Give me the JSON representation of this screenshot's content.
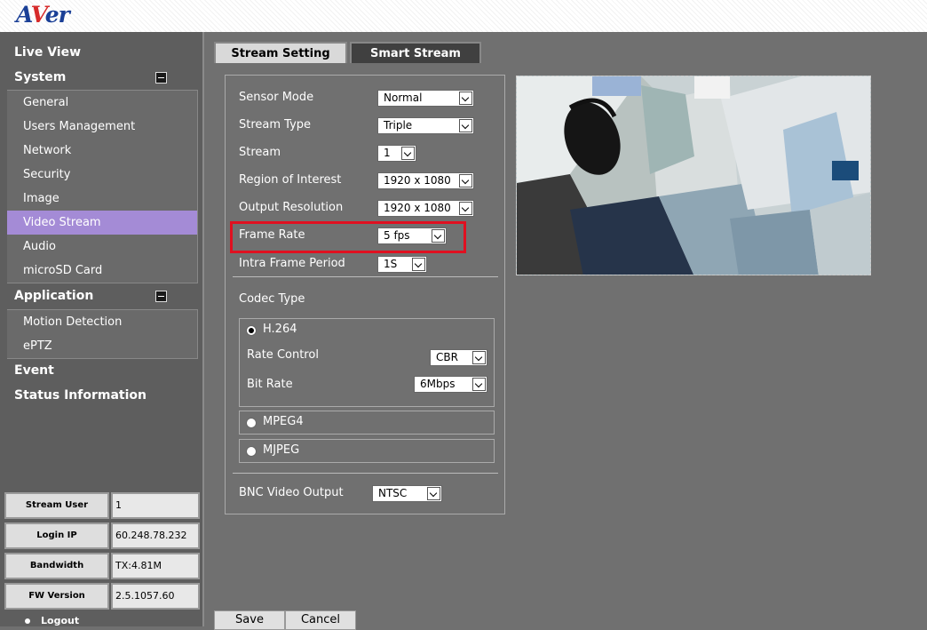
{
  "header": {
    "logo_a": "A",
    "logo_v": "V",
    "logo_er": "er"
  },
  "sidebar": {
    "live_view": "Live View",
    "system": {
      "label": "System",
      "items": [
        "General",
        "Users Management",
        "Network",
        "Security",
        "Image",
        "Video Stream",
        "Audio",
        "microSD Card"
      ],
      "active": "Video Stream"
    },
    "application": {
      "label": "Application",
      "items": [
        "Motion Detection",
        "ePTZ"
      ]
    },
    "event": "Event",
    "status_information": "Status Information",
    "info": [
      {
        "label": "Stream User",
        "value": "1"
      },
      {
        "label": "Login IP",
        "value": "60.248.78.232"
      },
      {
        "label": "Bandwidth",
        "value": "TX:4.81M"
      },
      {
        "label": "FW Version",
        "value": "2.5.1057.60"
      }
    ],
    "logout": "Logout"
  },
  "tabs": {
    "stream_setting": "Stream Setting",
    "smart_stream": "Smart Stream",
    "active": "Stream Setting"
  },
  "form": {
    "sensor_mode": {
      "label": "Sensor Mode",
      "value": "Normal"
    },
    "stream_type": {
      "label": "Stream Type",
      "value": "Triple"
    },
    "stream": {
      "label": "Stream",
      "value": "1"
    },
    "roi": {
      "label": "Region of Interest",
      "value": "1920 x 1080"
    },
    "output_resolution": {
      "label": "Output Resolution",
      "value": "1920 x 1080"
    },
    "frame_rate": {
      "label": "Frame Rate",
      "value": "5 fps"
    },
    "intra_frame_period": {
      "label": "Intra Frame Period",
      "value": "1S"
    },
    "codec_type": {
      "label": "Codec Type",
      "selected": "H.264"
    },
    "h264": {
      "label": "H.264",
      "rate_control": {
        "label": "Rate Control",
        "value": "CBR"
      },
      "bit_rate": {
        "label": "Bit Rate",
        "value": "6Mbps"
      }
    },
    "mpeg4": {
      "label": "MPEG4"
    },
    "mjpeg": {
      "label": "MJPEG"
    },
    "bnc_video_output": {
      "label": "BNC Video Output",
      "value": "NTSC"
    }
  },
  "buttons": {
    "save": "Save",
    "cancel": "Cancel"
  },
  "colors": {
    "highlight": "#e01020",
    "active_item": "#a48bd6",
    "logo_blue": "#1a3f96",
    "logo_red": "#d62a2a"
  }
}
